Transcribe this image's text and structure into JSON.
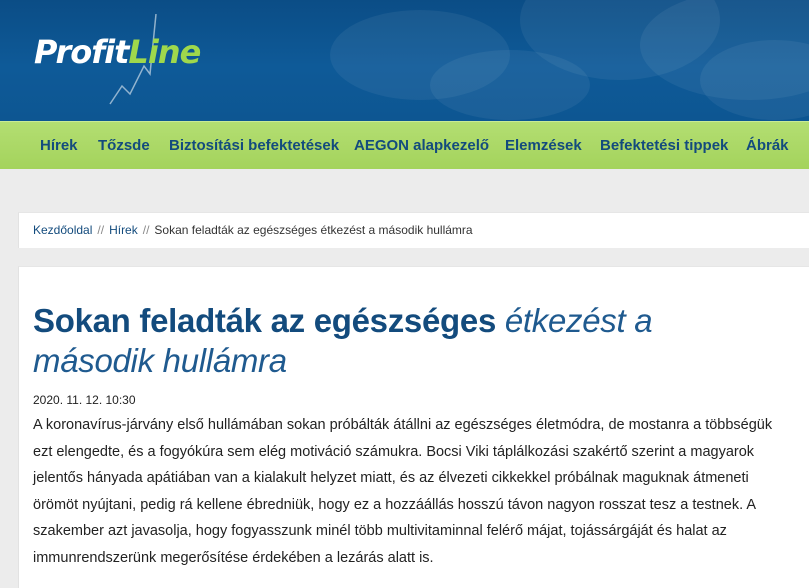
{
  "brand": {
    "logo_part1": "Profit",
    "logo_part2": "Line"
  },
  "colors": {
    "header_blue": "#0e5a98",
    "nav_green": "#a8d562",
    "link_blue": "#134b7d",
    "logo_green": "#9fd84c"
  },
  "nav": {
    "items": [
      {
        "label": "Hírek"
      },
      {
        "label": "Tőzsde"
      },
      {
        "label": "Biztosítási befektetések"
      },
      {
        "label": "AEGON alapkezelő"
      },
      {
        "label": "Elemzések"
      },
      {
        "label": "Befektetési tippek"
      },
      {
        "label": "Ábrák"
      }
    ]
  },
  "breadcrumb": {
    "home": "Kezdőoldal",
    "section": "Hírek",
    "current": "Sokan feladták az egészséges étkezést a második hullámra",
    "separator": "//"
  },
  "article": {
    "title_bold": "Sokan feladták az egészséges",
    "title_italic": "étkezést a második hullámra",
    "date": "2020. 11. 12. 10:30",
    "body": "A koronavírus-járvány első hullámában sokan próbálták átállni az egészséges életmódra, de mostanra a többségük ezt elengedte, és a fogyókúra sem elég motiváció számukra. Bocsi Viki táplálkozási szakértő szerint a magyarok jelentős hányada apátiában van a kialakult helyzet miatt, és az élvezeti cikkekkel próbálnak maguknak átmeneti örömöt nyújtani, pedig rá kellene ébredniük, hogy ez a hozzáállás hosszú távon nagyon rosszat tesz a testnek. A szakember azt javasolja, hogy fogyasszunk minél több multivitaminnal felérő májat, tojássárgáját és halat az immunrendszerünk megerősítése érdekében a lezárás alatt is."
  }
}
